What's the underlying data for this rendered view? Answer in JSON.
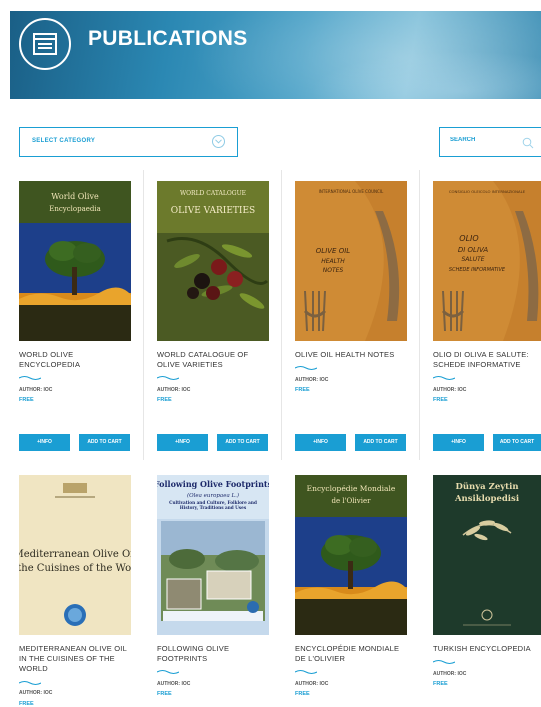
{
  "header": {
    "title": "PUBLICATIONS"
  },
  "filters": {
    "category_label": "SELECT CATEGORY",
    "search_placeholder": "SEARCH"
  },
  "colors": {
    "accent": "#1a9ed3",
    "banner": "#2b88b3"
  },
  "cards": [
    {
      "title": "WORLD OLIVE ENCYCLOPEDIA",
      "author": "AUTHOR: IOC",
      "price": "FREE",
      "info_label": "+INFO",
      "cart_label": "ADD TO CART",
      "cover_text": [
        "World Olive",
        "Encyclopaedia"
      ]
    },
    {
      "title": "WORLD CATALOGUE OF OLIVE VARIETIES",
      "author": "AUTHOR: IOC",
      "price": "FREE",
      "info_label": "+INFO",
      "cart_label": "ADD TO CART",
      "cover_text": [
        "WORLD CATALOGUE",
        "OLIVE VARIETIES"
      ]
    },
    {
      "title": "OLIVE OIL HEALTH NOTES",
      "author": "AUTHOR: IOC",
      "price": "FREE",
      "info_label": "+INFO",
      "cart_label": "ADD TO CART",
      "cover_text": [
        "INTERNATIONAL OLIVE COUNCIL",
        "OLIVE OIL",
        "HEALTH",
        "NOTES"
      ]
    },
    {
      "title": "OLIO DI OLIVA E SALUTE: SCHEDE INFORMATIVE",
      "author": "AUTHOR: IOC",
      "price": "FREE",
      "info_label": "+INFO",
      "cart_label": "ADD TO CART",
      "cover_text": [
        "CONSIGLIO OLEICOLO INTERNAZIONALE",
        "OLIO",
        "DI OLIVA",
        "SALUTE",
        "SCHEDE INFORMATIVE"
      ]
    },
    {
      "title": "MEDITERRANEAN OLIVE OIL IN THE CUISINES OF THE WORLD",
      "author": "AUTHOR: IOC",
      "price": "FREE",
      "cover_text": [
        "Mediterranean Olive Oil",
        "in the Cuisines of the World"
      ]
    },
    {
      "title": "FOLLOWING OLIVE FOOTPRINTS",
      "author": "AUTHOR: IOC",
      "price": "FREE",
      "cover_text": [
        "Following Olive Footprints",
        "(Olea europaea L.)",
        "Cultivation and Culture, Folklore and History, Traditions and Uses"
      ]
    },
    {
      "title": "ENCYCLOPÉDIE MONDIALE DE L'OLIVIER",
      "author": "AUTHOR: IOC",
      "price": "FREE",
      "cover_text": [
        "Encyclopédie Mondiale",
        "de l'Olivier"
      ]
    },
    {
      "title": "TURKISH ENCYCLOPEDIA",
      "author": "AUTHOR: IOC",
      "price": "FREE",
      "cover_text": [
        "Dünya Zeytin",
        "Ansiklopedisi"
      ]
    }
  ]
}
